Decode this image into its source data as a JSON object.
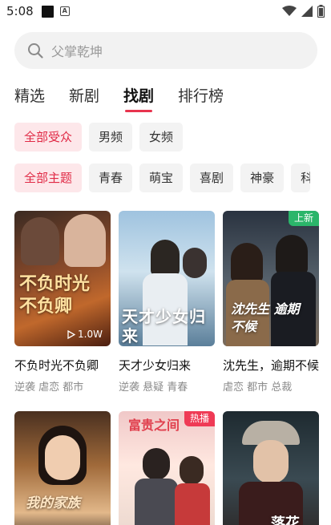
{
  "status": {
    "time": "5:08"
  },
  "search": {
    "placeholder": "父掌乾坤"
  },
  "tabs": [
    "精选",
    "新剧",
    "找剧",
    "排行榜"
  ],
  "audience_chips": [
    "全部受众",
    "男频",
    "女频"
  ],
  "theme_chips": [
    "全部主题",
    "青春",
    "萌宝",
    "喜剧",
    "神豪",
    "科"
  ],
  "cards": [
    {
      "title": "不负时光不负卿",
      "tags": "逆袭 虐恋 都市",
      "plays": "1.0W",
      "poster_text": "不负时光 不负卿"
    },
    {
      "title": "天才少女归来",
      "tags": "逆袭 悬疑 青春",
      "poster_text": "天才少女归来"
    },
    {
      "title": "沈先生，逾期不候",
      "tags": "虐恋 都市 总裁",
      "badge": "上新",
      "poster_text": "沈先生 逾期不候"
    },
    {
      "title": "",
      "tags": "",
      "poster_text": "我的家族"
    },
    {
      "title": "",
      "tags": "",
      "badge": "热播",
      "poster_text": "富贵之间"
    },
    {
      "title": "",
      "tags": "",
      "poster_text": "落花"
    }
  ],
  "colors": {
    "accent": "#e8344e",
    "chip_active_bg": "#fde7ea",
    "badge_new": "#2bb56a",
    "badge_hot": "#ef3a55"
  }
}
